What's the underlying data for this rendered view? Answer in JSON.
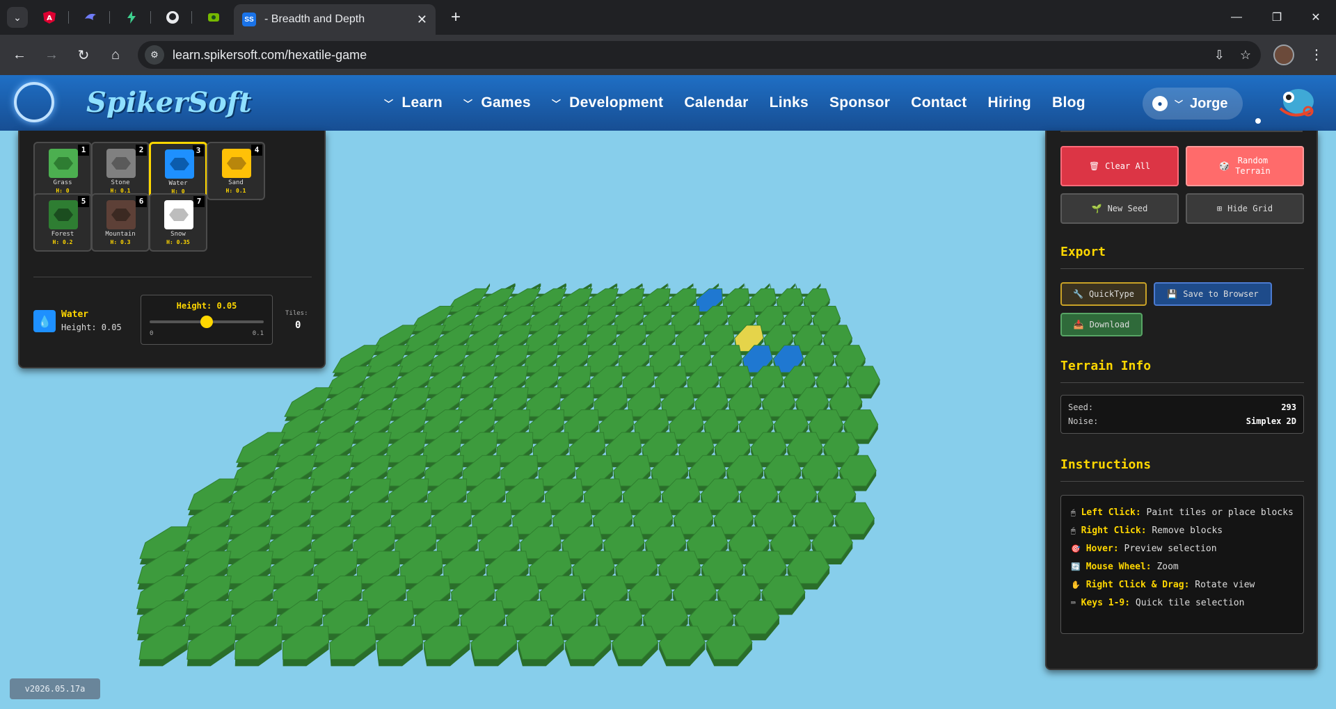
{
  "browser": {
    "active_tab_title": "- Breadth and Depth",
    "url": "learn.spikersoft.com/hexatile-game"
  },
  "site": {
    "logo": "SpikerSoft",
    "nav": [
      {
        "label": "Learn",
        "dropdown": true
      },
      {
        "label": "Games",
        "dropdown": true
      },
      {
        "label": "Development",
        "dropdown": true
      },
      {
        "label": "Calendar",
        "dropdown": false
      },
      {
        "label": "Links",
        "dropdown": false
      },
      {
        "label": "Sponsor",
        "dropdown": false
      },
      {
        "label": "Contact",
        "dropdown": false
      },
      {
        "label": "Hiring",
        "dropdown": false
      },
      {
        "label": "Blog",
        "dropdown": false
      }
    ],
    "user": "Jorge"
  },
  "palette": {
    "tiles": [
      {
        "num": "1",
        "name": "Grass",
        "height": "H: 0",
        "color": "#4caf50",
        "hex": "#2e7d32",
        "selected": false
      },
      {
        "num": "2",
        "name": "Stone",
        "height": "H: 0.1",
        "color": "#808080",
        "hex": "#5a5a5a",
        "selected": false
      },
      {
        "num": "3",
        "name": "Water",
        "height": "H: 0",
        "color": "#1e90ff",
        "hex": "#0b5cad",
        "selected": true
      },
      {
        "num": "4",
        "name": "Sand",
        "height": "H: 0.1",
        "color": "#ffc107",
        "hex": "#b8860b",
        "selected": false
      },
      {
        "num": "5",
        "name": "Forest",
        "height": "H: 0.2",
        "color": "#2e7d32",
        "hex": "#1b4d1f",
        "selected": false
      },
      {
        "num": "6",
        "name": "Mountain",
        "height": "H: 0.3",
        "color": "#5d4037",
        "hex": "#3b2922",
        "selected": false
      },
      {
        "num": "7",
        "name": "Snow",
        "height": "H: 0.35",
        "color": "#ffffff",
        "hex": "#bdbdbd",
        "selected": false
      }
    ],
    "selected": {
      "icon": "💧",
      "name": "Water",
      "height": "Height: 0.05"
    },
    "height_slider": {
      "label": "Height: 0.05",
      "min": "0",
      "max": "0.1",
      "value": 0.05,
      "min_value": 0,
      "max_value": 0.1
    },
    "tiles_label": "Tiles:",
    "tiles_count": "0"
  },
  "right_panel": {
    "clear_all": "Clear All",
    "random_terrain": "Random\nTerrain",
    "new_seed": "New Seed",
    "hide_grid": "Hide Grid",
    "export_title": "Export",
    "quicktype": "QuickType",
    "save_browser": "Save to Browser",
    "download": "Download",
    "info_title": "Terrain Info",
    "seed_label": "Seed:",
    "seed_value": "293",
    "noise_label": "Noise:",
    "noise_value": "Simplex 2D",
    "instructions_title": "Instructions",
    "instructions": [
      {
        "icon": "🖱",
        "key": "Left Click:",
        "text": " Paint tiles or place blocks"
      },
      {
        "icon": "🖱",
        "key": "Right Click:",
        "text": " Remove blocks"
      },
      {
        "icon": "🎯",
        "key": "Hover:",
        "text": " Preview selection"
      },
      {
        "icon": "🔄",
        "key": "Mouse Wheel:",
        "text": " Zoom"
      },
      {
        "icon": "✋",
        "key": "Right Click & Drag:",
        "text": " Rotate view"
      },
      {
        "icon": "⌨",
        "key": "Keys 1-9:",
        "text": " Quick tile selection"
      }
    ]
  },
  "version": "v2026.05.17a",
  "colors": {
    "grass": "#3d9b3d",
    "grass_dark": "#2a6e2a",
    "water": "#1f78d1",
    "sand": "#e5d44a",
    "sky": "#87ceeb"
  }
}
